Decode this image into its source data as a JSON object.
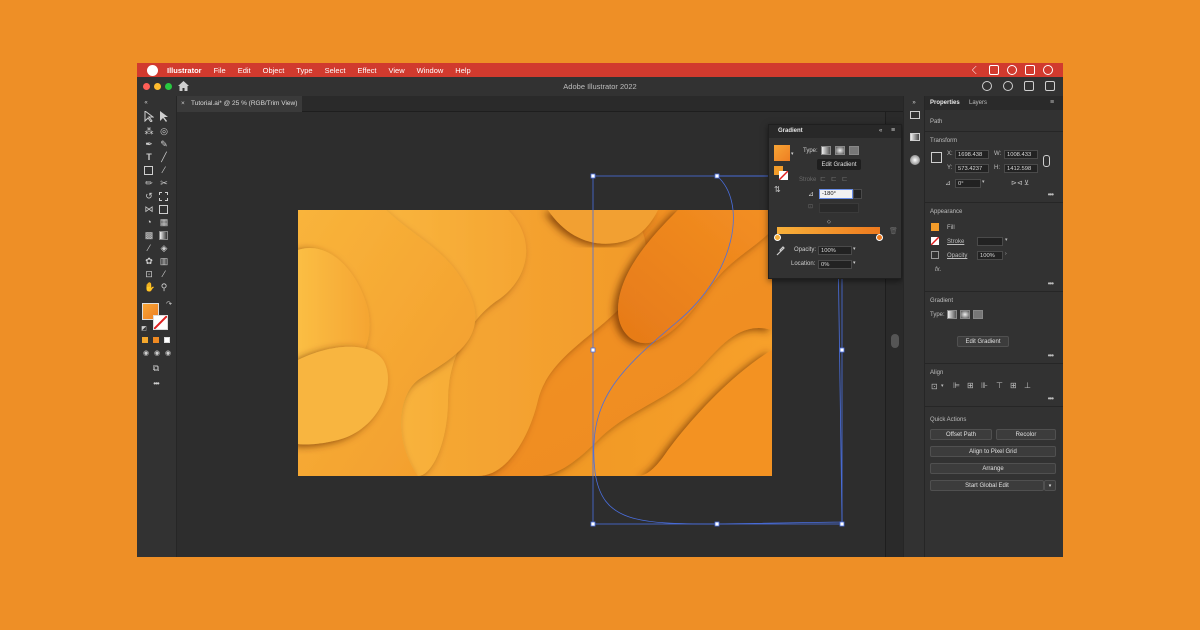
{
  "menubar": {
    "app_name": "Illustrator",
    "menus": [
      "File",
      "Edit",
      "Object",
      "Type",
      "Select",
      "Effect",
      "View",
      "Window",
      "Help"
    ]
  },
  "titlebar": {
    "title": "Adobe Illustrator 2022"
  },
  "document_tab": {
    "close": "×",
    "label": "Tutorial.ai* @ 25 % (RGB/Trim View)"
  },
  "gradient_panel": {
    "title": "Gradient",
    "type_label": "Type:",
    "edit_gradient_tooltip": "Edit Gradient",
    "stroke_label": "Stroke",
    "angle_value": "-180°",
    "opacity_label": "Opacity:",
    "opacity_value": "100%",
    "location_label": "Location:",
    "location_value": "0%",
    "ramp_start_color": "#F7B03A",
    "ramp_end_color": "#EE7A1E"
  },
  "properties": {
    "tabs": [
      "Properties",
      "Layers"
    ],
    "selection_type": "Path",
    "transform": {
      "title": "Transform",
      "x_label": "X:",
      "x_value": "1698.438",
      "y_label": "Y:",
      "y_value": "573.4237",
      "w_label": "W:",
      "w_value": "1008.433",
      "h_label": "H:",
      "h_value": "1412.598",
      "rotate_value": "0°"
    },
    "appearance": {
      "title": "Appearance",
      "fill_label": "Fill",
      "stroke_label": "Stroke",
      "opacity_label": "Opacity",
      "opacity_value": "100%",
      "fx_label": "fx."
    },
    "gradient": {
      "title": "Gradient",
      "type_label": "Type:",
      "edit_button": "Edit Gradient"
    },
    "align": {
      "title": "Align"
    },
    "quick_actions": {
      "title": "Quick Actions",
      "offset_path": "Offset Path",
      "recolor": "Recolor",
      "align_pixel_grid": "Align to Pixel Grid",
      "arrange": "Arrange",
      "start_global_edit": "Start Global Edit"
    }
  },
  "colors": {
    "background": "#EE8F26",
    "menubar": "#D13A2E",
    "panel": "#323232",
    "canvas": "#2D2D2D",
    "selection": "#4A6FE0",
    "fill_orange": "#F39C2A"
  }
}
